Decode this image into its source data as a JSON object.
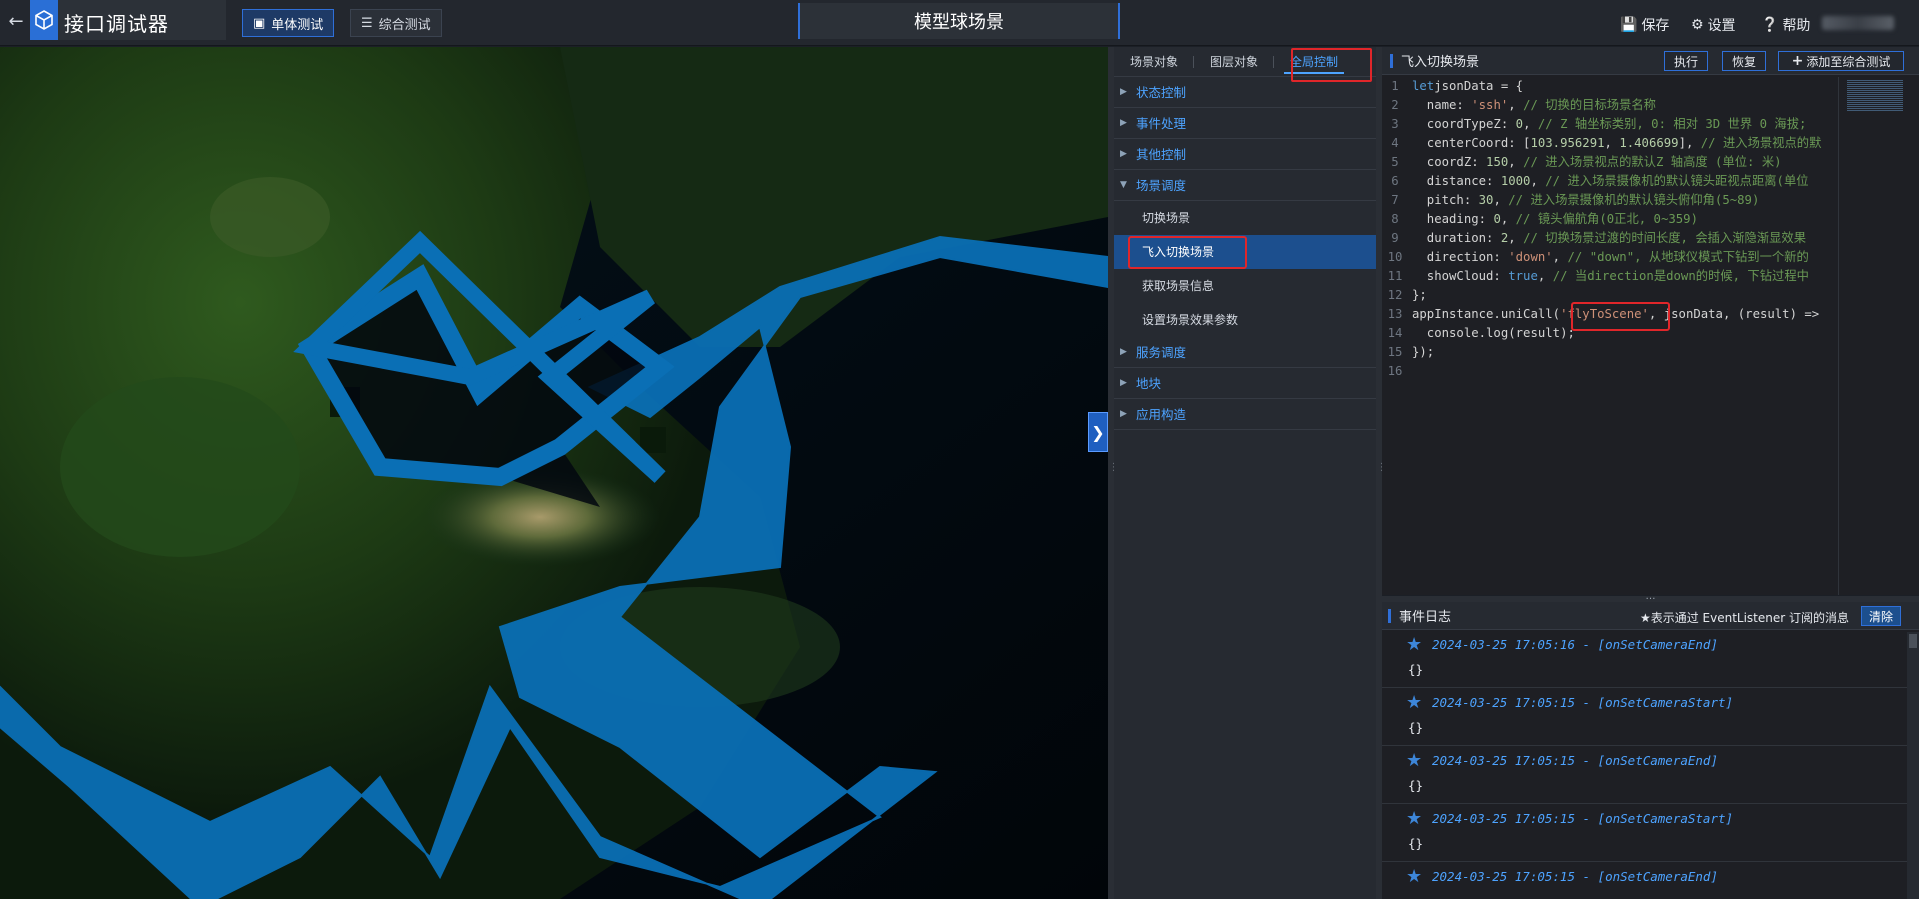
{
  "app": {
    "title": "接口调试器"
  },
  "modes": [
    {
      "label": "单体测试",
      "icon": "cube-icon"
    },
    {
      "label": "综合测试",
      "icon": "layers-icon"
    }
  ],
  "scene_title": "模型球场景",
  "top_actions": {
    "save": "保存",
    "settings": "设置",
    "help": "帮助"
  },
  "tabs": [
    "场景对象",
    "图层对象",
    "全局控制"
  ],
  "tree": [
    {
      "label": "状态控制"
    },
    {
      "label": "事件处理"
    },
    {
      "label": "其他控制"
    },
    {
      "label": "场景调度",
      "children": [
        "切换场景",
        "飞入切换场景",
        "获取场景信息",
        "设置场景效果参数"
      ]
    },
    {
      "label": "服务调度"
    },
    {
      "label": "地块"
    },
    {
      "label": "应用构造"
    }
  ],
  "code_panel": {
    "title": "飞入切换场景",
    "run": "执行",
    "restore": "恢复",
    "add": "添加至综合测试",
    "lines": [
      [
        [
          "kw",
          "let"
        ],
        [
          "",
          "jsonData = {"
        ]
      ],
      [
        [
          "",
          "  name: "
        ],
        [
          "str",
          "'ssh'"
        ],
        [
          "",
          ", "
        ],
        [
          "cmt",
          "// 切换的目标场景名称"
        ]
      ],
      [
        [
          "",
          "  coordTypeZ: "
        ],
        [
          "num",
          "0"
        ],
        [
          "",
          ", "
        ],
        [
          "cmt",
          "// Z 轴坐标类别, 0: 相对 3D 世界 0 海拔;"
        ]
      ],
      [
        [
          "",
          "  centerCoord: ["
        ],
        [
          "num",
          "103.956291"
        ],
        [
          "",
          ", "
        ],
        [
          "num",
          "1.406699"
        ],
        [
          "",
          "], "
        ],
        [
          "cmt",
          "// 进入场景视点的默"
        ]
      ],
      [
        [
          "",
          "  coordZ: "
        ],
        [
          "num",
          "150"
        ],
        [
          "",
          ", "
        ],
        [
          "cmt",
          "// 进入场景视点的默认Z 轴高度 (单位: 米)"
        ]
      ],
      [
        [
          "",
          "  distance: "
        ],
        [
          "num",
          "1000"
        ],
        [
          "",
          ", "
        ],
        [
          "cmt",
          "// 进入场景摄像机的默认镜头距视点距离(单位"
        ]
      ],
      [
        [
          "",
          "  pitch: "
        ],
        [
          "num",
          "30"
        ],
        [
          "",
          ", "
        ],
        [
          "cmt",
          "// 进入场景摄像机的默认镜头俯仰角(5~89)"
        ]
      ],
      [
        [
          "",
          "  heading: "
        ],
        [
          "num",
          "0"
        ],
        [
          "",
          ", "
        ],
        [
          "cmt",
          "// 镜头偏航角(0正北, 0~359)"
        ]
      ],
      [
        [
          "",
          "  duration: "
        ],
        [
          "num",
          "2"
        ],
        [
          "",
          ", "
        ],
        [
          "cmt",
          "// 切换场景过渡的时间长度, 会插入渐隐渐显效果"
        ]
      ],
      [
        [
          "",
          "  direction: "
        ],
        [
          "str",
          "'down'"
        ],
        [
          "",
          ", "
        ],
        [
          "cmt",
          "// \"down\", 从地球仪模式下钻到一个新的"
        ]
      ],
      [
        [
          "",
          "  showCloud: "
        ],
        [
          "kw",
          "true"
        ],
        [
          "",
          ", "
        ],
        [
          "cmt",
          "// 当direction是down的时候, 下钻过程中"
        ]
      ],
      [
        [
          "",
          "};"
        ]
      ],
      [
        [
          "",
          "appInstance.uniCall("
        ],
        [
          "str",
          "'flyToScene'"
        ],
        [
          "",
          ", jsonData, (result) =>"
        ]
      ],
      [
        [
          "",
          "  console.log(result);"
        ]
      ],
      [
        [
          "",
          "});"
        ]
      ],
      [
        [
          "",
          ""
        ]
      ]
    ]
  },
  "event_log": {
    "title": "事件日志",
    "note": "★表示通过 EventListener 订阅的消息",
    "clear": "清除",
    "entries": [
      {
        "time": "2024-03-25 17:05:16",
        "event": "onSetCameraEnd",
        "head": "2024-03-25 17:05:16 - [onSetCameraEnd]",
        "body": "{}"
      },
      {
        "time": "2024-03-25 17:05:15",
        "event": "onSetCameraStart",
        "head": "2024-03-25 17:05:15 - [onSetCameraStart]",
        "body": "{}"
      },
      {
        "time": "2024-03-25 17:05:15",
        "event": "onSetCameraEnd",
        "head": "2024-03-25 17:05:15 - [onSetCameraEnd]",
        "body": "{}"
      },
      {
        "time": "2024-03-25 17:05:15",
        "event": "onSetCameraStart",
        "head": "2024-03-25 17:05:15 - [onSetCameraStart]",
        "body": "{}"
      },
      {
        "time": "2024-03-25 17:05:15",
        "event": "onSetCameraEnd",
        "head": "2024-03-25 17:05:15 - [onSetCameraEnd]",
        "body": ""
      }
    ]
  },
  "colors": {
    "accent": "#2f6fd8",
    "link": "#4da3ff",
    "highlight": "#e0262a",
    "selected": "#1c4f8e",
    "route": "#0a6fb5"
  }
}
